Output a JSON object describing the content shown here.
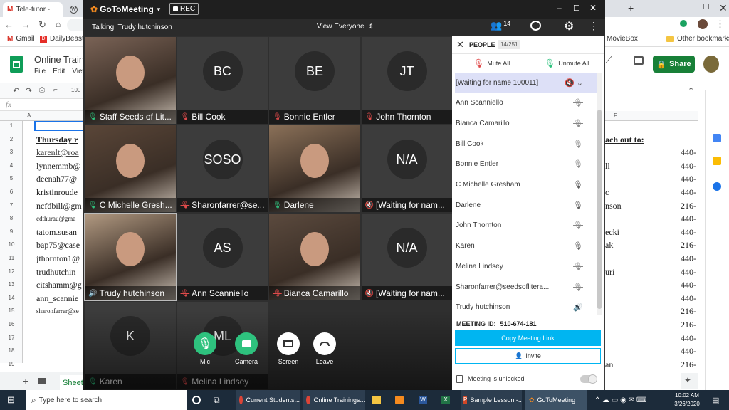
{
  "browser": {
    "tabs": [
      "Tele-tutor -",
      "Tale-tutor"
    ],
    "bookmarks": [
      "Gmail",
      "DailyBeast",
      "MovieBox",
      "Other bookmarks"
    ]
  },
  "sheets": {
    "title": "Online Trainin",
    "menu": [
      "File",
      "Edit",
      "View"
    ],
    "zoom": "100",
    "fx": "fx",
    "share_label": "Share",
    "sheet_tab": "Sheet1",
    "col_a": "A",
    "col_f": "F",
    "rows": [
      "1",
      "2",
      "3",
      "4",
      "5",
      "6",
      "7",
      "8",
      "9",
      "10",
      "11",
      "12",
      "13",
      "14",
      "15",
      "16",
      "17",
      "18",
      "19"
    ],
    "left_cells": [
      "",
      "Thursday r",
      "karenlt@roa",
      "lynnemmb@",
      "deenah77@",
      "kristinroude",
      "ncfdbill@gm",
      "cdthurau@gma",
      "tatom.susan",
      "bap75@case",
      "jthornton1@",
      "trudhutchin",
      "citshamm@g",
      "ann_scannie",
      "sharonfarrer@se",
      "",
      "",
      "",
      ""
    ],
    "right_cells": [
      "",
      "ach out to:",
      "",
      "ll",
      "",
      "c",
      "nson",
      "",
      "ecki",
      "ak",
      "",
      "uri",
      "",
      "",
      "",
      "",
      "",
      "",
      "an"
    ],
    "right_nums": [
      "",
      "",
      "440-",
      "440-",
      "440-",
      "440-",
      "216-",
      "440-",
      "440-",
      "216-",
      "440-",
      "440-",
      "440-",
      "440-",
      "216-",
      "216-",
      "440-",
      "440-",
      "216-"
    ]
  },
  "gtm": {
    "brand": "GoToMeeting",
    "rec": "REC",
    "people_count": "14",
    "talking": "Talking: Trudy hutchinson",
    "view": "View Everyone",
    "tiles": [
      {
        "initials": "",
        "name": "Staff Seeds of Lit...",
        "mic": "on",
        "photo": true
      },
      {
        "initials": "BC",
        "name": "Bill Cook",
        "mic": "muted"
      },
      {
        "initials": "BE",
        "name": "Bonnie Entler",
        "mic": "muted"
      },
      {
        "initials": "JT",
        "name": "John Thornton",
        "mic": "muted"
      },
      {
        "initials": "",
        "name": "C Michelle Gresh...",
        "mic": "on",
        "photo": true
      },
      {
        "initials": "SOSO",
        "name": "Sharonfarrer@se...",
        "mic": "muted"
      },
      {
        "initials": "",
        "name": "Darlene",
        "mic": "on",
        "photo": true
      },
      {
        "initials": "N/A",
        "name": "[Waiting for nam...",
        "mic": "speaker-muted"
      },
      {
        "initials": "",
        "name": "Trudy hutchinson",
        "mic": "speaking",
        "photo": true
      },
      {
        "initials": "AS",
        "name": "Ann Scanniello",
        "mic": "muted"
      },
      {
        "initials": "",
        "name": "Bianca Camarillo",
        "mic": "muted",
        "photo": true
      },
      {
        "initials": "N/A",
        "name": "[Waiting for nam...",
        "mic": "speaker-muted"
      },
      {
        "initials": "K",
        "name": "Karen",
        "mic": "on"
      },
      {
        "initials": "ML",
        "name": "Melina Lindsey",
        "mic": "muted"
      }
    ],
    "controls": [
      "Mic",
      "Camera",
      "Screen",
      "Leave"
    ],
    "panel": {
      "title": "PEOPLE",
      "count": "14/251",
      "mute_all": "Mute All",
      "unmute_all": "Unmute All",
      "people": [
        {
          "name": "[Waiting for name 100011]",
          "mic": "speaker-muted",
          "selected": true
        },
        {
          "name": "Ann Scanniello",
          "mic": "muted"
        },
        {
          "name": "Bianca Camarillo",
          "mic": "muted"
        },
        {
          "name": "Bill Cook",
          "mic": "muted"
        },
        {
          "name": "Bonnie Entler",
          "mic": "muted"
        },
        {
          "name": "C Michelle Gresham",
          "mic": "on"
        },
        {
          "name": "Darlene",
          "mic": "on"
        },
        {
          "name": "John Thornton",
          "mic": "muted"
        },
        {
          "name": "Karen",
          "mic": "on"
        },
        {
          "name": "Melina Lindsey",
          "mic": "muted"
        },
        {
          "name": "Sharonfarrer@seedsoflitera...",
          "mic": "muted"
        },
        {
          "name": "Trudy hutchinson",
          "mic": "speaking"
        }
      ],
      "meeting_id_label": "MEETING ID:",
      "meeting_id": "510-674-181",
      "copy_link": "Copy Meeting Link",
      "invite": "Invite",
      "lock_status": "Meeting is unlocked"
    }
  },
  "taskbar": {
    "search": "Type here to search",
    "apps": [
      "Current Students...",
      "Online Trainings...",
      "Sample Lesson -...",
      "GoToMeeting"
    ],
    "time": "10:02 AM",
    "date": "3/26/2020"
  },
  "colors": {
    "accent": "#00b5f1",
    "mic_on": "#2ec27e",
    "mic_muted": "#e04b4b",
    "sheets_green": "#188038"
  }
}
